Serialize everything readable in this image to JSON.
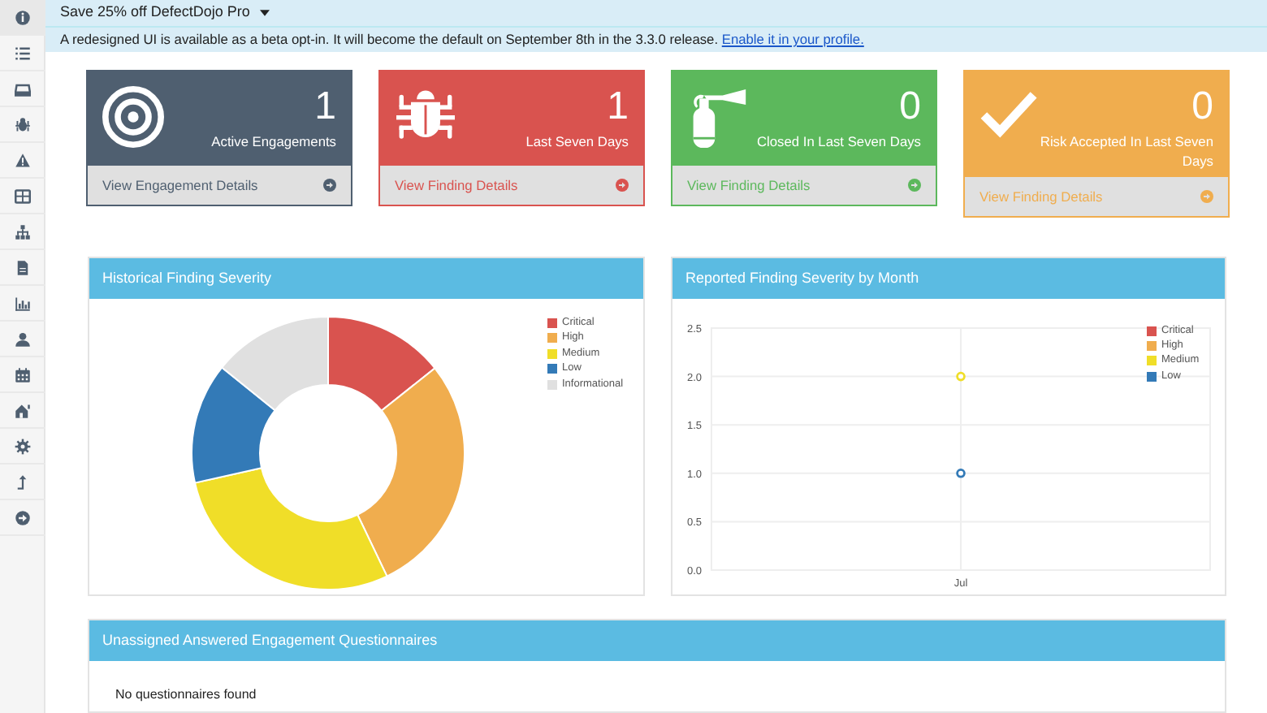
{
  "promo": {
    "label": "Save 25% off DefectDojo Pro"
  },
  "alert": {
    "text": "A redesigned UI is available as a beta opt-in. It will become the default on September 8th in the 3.3.0 release.",
    "link": "Enable it in your profile."
  },
  "cards": [
    {
      "count": "1",
      "label": "Active Engagements",
      "link": "View Engagement Details",
      "color": "#4f5f70"
    },
    {
      "count": "1",
      "label": "Last Seven Days",
      "link": "View Finding Details",
      "color": "#d9534f"
    },
    {
      "count": "0",
      "label": "Closed In Last Seven Days",
      "link": "View Finding Details",
      "color": "#5cb85c"
    },
    {
      "count": "0",
      "label": "Risk Accepted In Last Seven Days",
      "link": "View Finding Details",
      "color": "#f0ad4e"
    }
  ],
  "severity_panel": {
    "title": "Historical Finding Severity",
    "chart_data": {
      "type": "donut",
      "categories": [
        "Critical",
        "High",
        "Medium",
        "Low",
        "Informational"
      ],
      "values": [
        14.3,
        28.6,
        28.6,
        14.3,
        14.2
      ],
      "legend": true,
      "colors": [
        "#d9534f",
        "#f0ad4e",
        "#f0de28",
        "#337ab7",
        "#e0e0e0"
      ]
    }
  },
  "month_panel": {
    "title": "Reported Finding Severity by Month",
    "chart_data": {
      "type": "line",
      "categories": [
        "Jul"
      ],
      "legend": true,
      "grid": true,
      "ylim": [
        0,
        2.5
      ],
      "yticks": [
        {
          "value": 0,
          "label": "0.0"
        },
        {
          "value": 0.5,
          "label": "0.5"
        },
        {
          "value": 1,
          "label": "1.0"
        },
        {
          "value": 1.5,
          "label": "1.5"
        },
        {
          "value": 2,
          "label": "2.0"
        },
        {
          "value": 2.5,
          "label": "2.5"
        }
      ],
      "series": [
        {
          "name": "Critical",
          "color": "#d9534f",
          "values": [
            null
          ]
        },
        {
          "name": "High",
          "color": "#f0ad4e",
          "values": [
            null
          ]
        },
        {
          "name": "Medium",
          "color": "#f0de28",
          "values": [
            2
          ],
          "marker": "circle"
        },
        {
          "name": "Low",
          "color": "#337ab7",
          "values": [
            1
          ],
          "marker": "circle"
        }
      ]
    }
  },
  "questionnaires_panel": {
    "title": "Unassigned Answered Engagement Questionnaires",
    "empty_text": "No questionnaires found"
  }
}
